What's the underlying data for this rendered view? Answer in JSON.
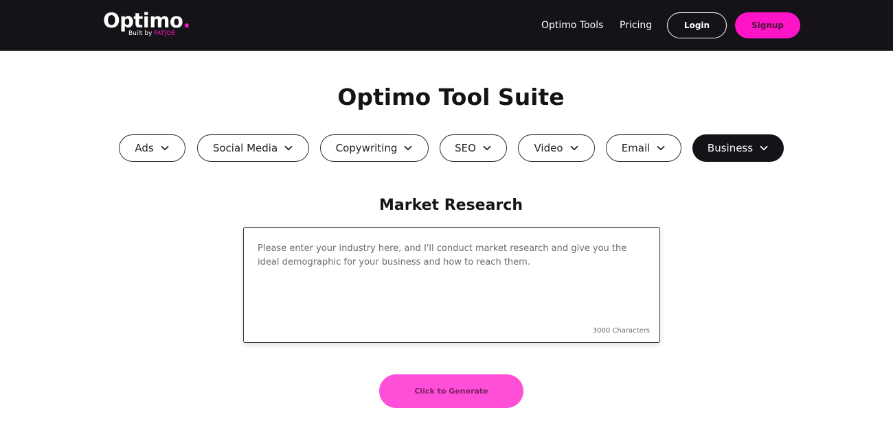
{
  "header": {
    "logo_word": "Optimo",
    "logo_dot": ".",
    "logo_built_by": "Built by ",
    "logo_brand": "FATJOE",
    "nav": [
      {
        "label": "Optimo Tools"
      },
      {
        "label": "Pricing"
      }
    ],
    "login_label": "Login",
    "signup_label": "Signup"
  },
  "page_title": "Optimo Tool Suite",
  "categories": [
    {
      "label": "Ads",
      "icon": "chevron-down-icon",
      "active": false
    },
    {
      "label": "Social Media",
      "icon": "chevron-down-icon",
      "active": false
    },
    {
      "label": "Copywriting",
      "icon": "chevron-down-icon",
      "active": false
    },
    {
      "label": "SEO",
      "icon": "chevron-down-icon",
      "active": false
    },
    {
      "label": "Video",
      "icon": "chevron-down-icon",
      "active": false
    },
    {
      "label": "Email",
      "icon": "chevron-down-icon",
      "active": false
    },
    {
      "label": "Business",
      "icon": "chevron-down-icon",
      "active": true
    }
  ],
  "tool": {
    "title": "Market Research",
    "input_value": "",
    "input_placeholder": "Please enter your industry here, and I'll conduct market research and give you the ideal demographic for your business and how to reach them.",
    "char_limit": "3000 Characters",
    "generate_label": "Click to Generate"
  },
  "colors": {
    "header_bg": "#151317",
    "accent_pink": "#ff14c8",
    "generate_pink": "#ff4fd8",
    "active_pill_bg": "#151317"
  }
}
